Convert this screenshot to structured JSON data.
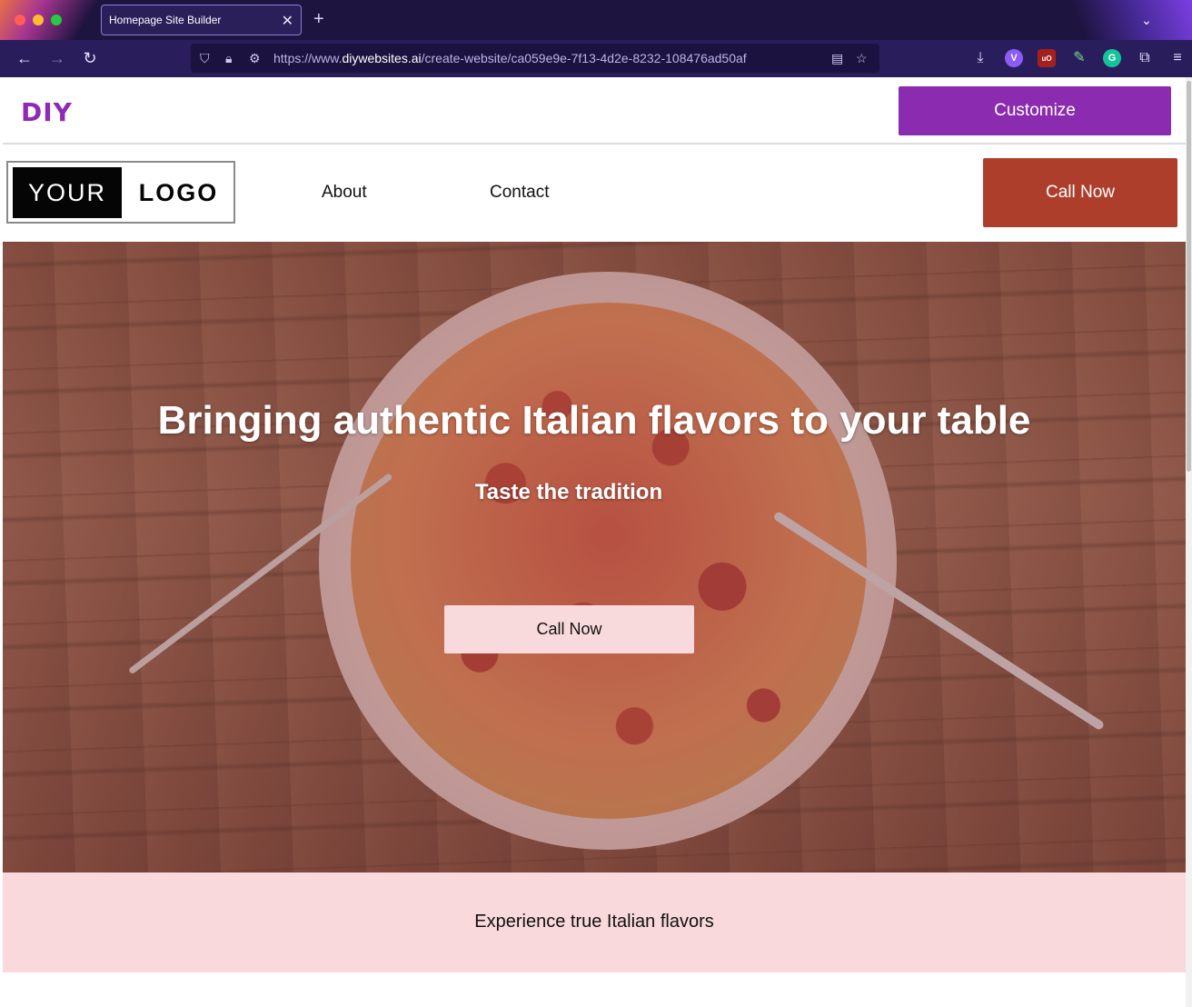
{
  "browser": {
    "tab_title": "Homepage Site Builder",
    "tab_close": "✕",
    "new_tab": "+",
    "tabs_menu": "⌄",
    "url_prefix": "https://www.",
    "url_host": "diywebsites.ai",
    "url_path": "/create-website/ca059e9e-7f13-4d2e-8232-108476ad50af",
    "extensions": [
      "download-icon",
      "v-extension-icon",
      "ublock-icon",
      "color-picker-icon",
      "grammarly-icon",
      "extensions-icon",
      "menu-icon"
    ],
    "ext_labels": {
      "v": "V",
      "ub": "uO",
      "g": "G"
    },
    "colors": {
      "chrome": "#1e1440",
      "toolbar": "#2a1d5c"
    }
  },
  "builder": {
    "logo": "DIY",
    "customize_label": "Customize",
    "accent": "#8a2bb0"
  },
  "site": {
    "logo": {
      "left": "YOUR",
      "right": "LOGO"
    },
    "nav": [
      "About",
      "Contact"
    ],
    "call_label": "Call Now",
    "call_color": "#ae3e2c"
  },
  "hero": {
    "title": "Bringing authentic Italian flavors to your table",
    "subtitle": "Taste the tradition",
    "cta_label": "Call Now"
  },
  "tagline": {
    "text": "Experience true Italian flavors",
    "bg": "#f9d9dc"
  }
}
